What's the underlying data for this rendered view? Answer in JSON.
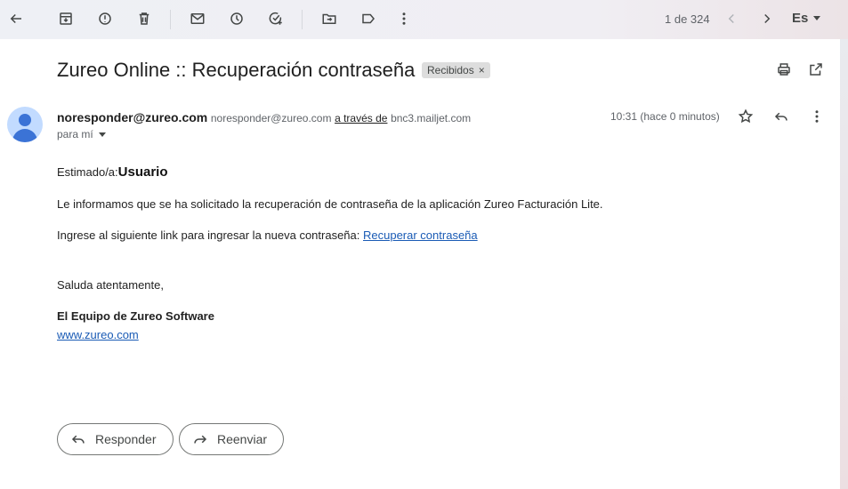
{
  "toolbar": {
    "icons": [
      "back-icon",
      "archive-icon",
      "report-spam-icon",
      "delete-icon",
      "mark-unread-icon",
      "snooze-icon",
      "add-task-icon",
      "move-to-icon",
      "label-icon",
      "more-vert-icon"
    ],
    "pager": "1 de 324",
    "language": "Es"
  },
  "email": {
    "subject": "Zureo Online :: Recuperación contraseña",
    "label": "Recibidos",
    "label_close": "×",
    "sender_name": "noresponder@zureo.com",
    "sender_email": "noresponder@zureo.com",
    "via_text": "a través de",
    "via_domain": "bnc3.mailjet.com",
    "to": "para mí",
    "time": "10:31 (hace 0 minutos)",
    "greeting_prefix": "Estimado/a:",
    "greeting_user": "Usuario",
    "paragraph1": "Le informamos que se ha solicitado la recuperación de contraseña de la aplicación Zureo Facturación Lite.",
    "paragraph2_prefix": "Ingrese al siguiente link para ingresar la nueva contraseña: ",
    "paragraph2_link": "Recuperar contraseña",
    "closing": "Saluda atentamente,",
    "team": "El Equipo de Zureo Software",
    "website": "www.zureo.com"
  },
  "actions": {
    "reply": "Responder",
    "forward": "Reenviar"
  },
  "colors": {
    "link": "#1a5bb5",
    "avatar_bg": "#c2dbff",
    "avatar_fg": "#3b73d6"
  }
}
